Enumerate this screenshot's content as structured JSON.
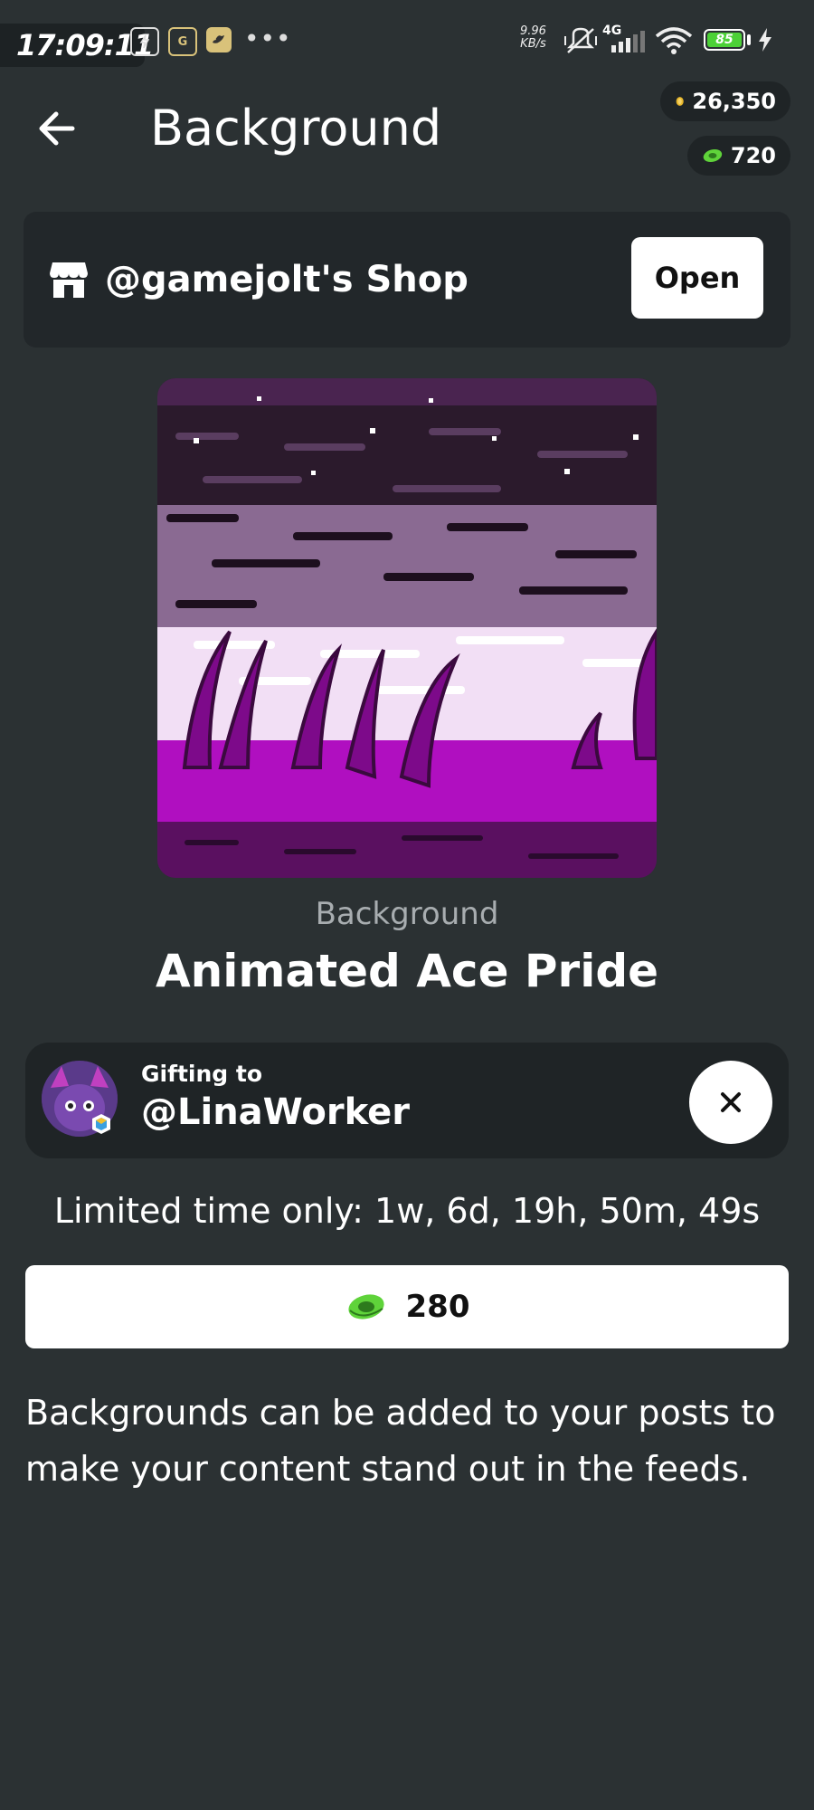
{
  "status_bar": {
    "time": "17:09:11",
    "app_icon_g": "G",
    "net_speed_value": "9.96",
    "net_speed_unit": "KB/s",
    "network": "4G",
    "battery": "85"
  },
  "header": {
    "title": "Background",
    "coins": "26,350",
    "gems": "720"
  },
  "shop": {
    "name": "@gamejolt's Shop",
    "open_label": "Open"
  },
  "item": {
    "type": "Background",
    "name": "Animated Ace Pride"
  },
  "gift": {
    "label": "Gifting to",
    "user": "@LinaWorker"
  },
  "limited_time": "Limited time only: 1w, 6d, 19h, 50m, 49s",
  "purchase": {
    "price": "280"
  },
  "description": "Backgrounds can be added to your posts to make your content stand out in the feeds.",
  "colors": {
    "background": "#2b3133",
    "card": "#1f2426",
    "gem_green": "#5fd33a",
    "coin_gold": "#e8b82c"
  }
}
